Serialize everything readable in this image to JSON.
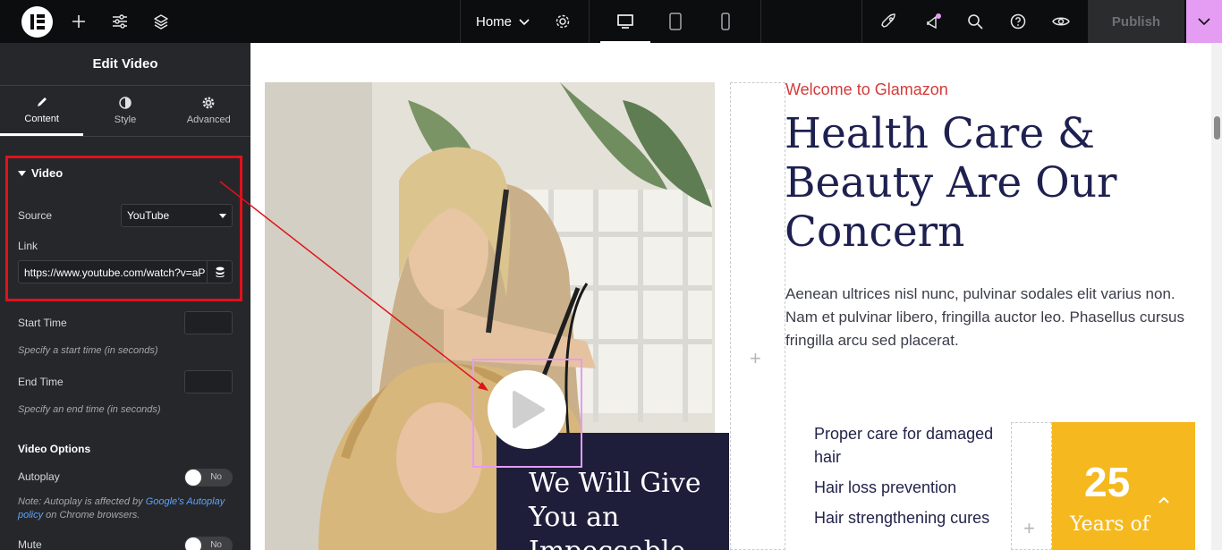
{
  "topbar": {
    "page_name": "Home",
    "publish_label": "Publish"
  },
  "panel": {
    "title": "Edit Video",
    "tabs": [
      {
        "label": "Content"
      },
      {
        "label": "Style"
      },
      {
        "label": "Advanced"
      }
    ],
    "section_title": "Video",
    "source_label": "Source",
    "source_value": "YouTube",
    "link_label": "Link",
    "link_value": "https://www.youtube.com/watch?v=aP",
    "start_time_label": "Start Time",
    "start_time_hint": "Specify a start time (in seconds)",
    "end_time_label": "End Time",
    "end_time_hint": "Specify an end time (in seconds)",
    "video_options_label": "Video Options",
    "autoplay_label": "Autoplay",
    "autoplay_toggle": "No",
    "autoplay_note_prefix": "Note: Autoplay is affected by ",
    "autoplay_note_link": "Google's Autoplay policy",
    "autoplay_note_suffix": " on Chrome browsers.",
    "mute_label": "Mute",
    "mute_toggle": "No"
  },
  "canvas": {
    "welcome": "Welcome to Glamazon",
    "heading": "Health Care & Beauty Are Our Concern",
    "paragraph": "Aenean ultrices nisl nunc, pulvinar sodales elit varius non. Nam et pulvinar libero, fringilla auctor leo. Phasellus cursus fringilla arcu sed placerat.",
    "list": [
      "Proper care for damaged hair",
      "Hair loss prevention",
      "Hair strengthening cures"
    ],
    "years_number": "25",
    "years_text": "Years of",
    "dark_box_text": "We Will Give You an Impeccable"
  },
  "colors": {
    "topbar_bg": "#0c0d0e",
    "panel_bg": "#26272b",
    "accent_pink": "#e59cf3",
    "highlight_red": "#e0121a",
    "heading_navy": "#1e2050",
    "welcome_red": "#d43a3a",
    "stat_yellow": "#f5b91f"
  }
}
